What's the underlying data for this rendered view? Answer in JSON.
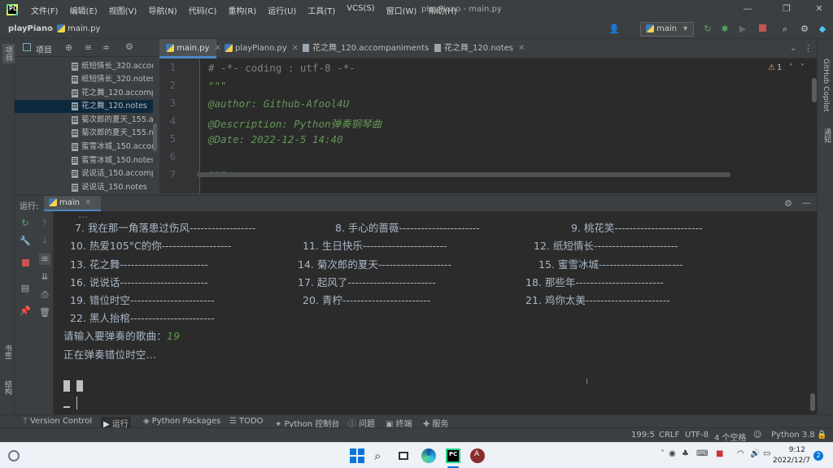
{
  "titlebar": {
    "menu": [
      "文件(F)",
      "编辑(E)",
      "视图(V)",
      "导航(N)",
      "代码(C)",
      "重构(R)",
      "运行(U)",
      "工具(T)",
      "VCS(S)",
      "窗口(W)",
      "帮助(H)"
    ],
    "title": "playPiano - main.py"
  },
  "navbar": {
    "project": "playPiano",
    "file": "main.py",
    "run_config": "main"
  },
  "left_stripe": {
    "project_label": "项目",
    "bookmarks_label": "书签",
    "structure_label": "结构"
  },
  "right_stripe": {
    "copilot_label": "GitHub Copilot",
    "notifications_label": "通知"
  },
  "project_panel": {
    "title": "项目",
    "files": [
      "纸短情长_320.accon",
      "纸短情长_320.notes",
      "花之舞_120.accomp",
      "花之舞_120.notes",
      "菊次郎的夏天_155.ac",
      "菊次郎的夏天_155.nc",
      "蜜雪冰城_150.accon",
      "蜜雪冰城_150.notes",
      "说说话_150.accomp",
      "说说话_150.notes"
    ],
    "selected_index": 3
  },
  "tabs": [
    "main.py",
    "playPiano.py",
    "花之舞_120.accompaniments",
    "花之舞_120.notes"
  ],
  "editor": {
    "line_numbers": [
      "1",
      "2",
      "3",
      "4",
      "5",
      "6",
      "7"
    ],
    "lines": [
      "# -*- coding : utf-8 -*-",
      "\"\"\"",
      "@author: Github-Afool4U",
      "@Description: Python弹奏钢琴曲",
      "@Date: 2022-12-5 14:40",
      "",
      "\"\"\""
    ],
    "inspection": "1"
  },
  "run_panel": {
    "label": "运行:",
    "tab": "main",
    "songs_rows": [
      [
        "7. 我在那一角落患过伤风------------------",
        "8. 手心的蔷薇----------------------",
        "9. 桃花笑------------------------"
      ],
      [
        "10. 热爱105°C的你-------------------",
        "11. 生日快乐-----------------------",
        "12. 纸短情长-----------------------"
      ],
      [
        "13. 花之舞------------------------",
        "14. 菊次郎的夏天--------------------",
        "15. 蜜雪冰城-----------------------"
      ],
      [
        "16. 说说话------------------------",
        "17. 起风了------------------------",
        "18. 那些年------------------------"
      ],
      [
        "19. 错位时空-----------------------",
        "20. 青柠------------------------",
        "21. 鸡你太美-----------------------"
      ],
      [
        "22. 黑人抬棺-----------------------",
        "",
        ""
      ]
    ],
    "prompt": "请输入要弹奏的歌曲：",
    "input_value": "19",
    "playing": "正在弹奏错位时空..."
  },
  "toolwindows": [
    "Version Control",
    "运行",
    "Python Packages",
    "TODO",
    "Python 控制台",
    "问题",
    "终端",
    "服务"
  ],
  "statusbar": {
    "position": "199:5",
    "line_sep": "CRLF",
    "encoding": "UTF-8",
    "indent": "4 个空格",
    "interpreter": "Python 3.8"
  },
  "taskbar": {
    "time": "9:12",
    "date": "2022/12/7",
    "notification_count": "2"
  }
}
